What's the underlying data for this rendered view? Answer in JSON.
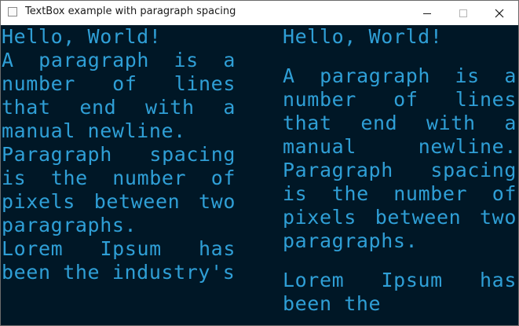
{
  "window": {
    "title": "TextBox example with paragraph spacing",
    "minimize_icon": "minimize-icon",
    "maximize_icon": "maximize-icon",
    "close_icon": "close-icon"
  },
  "colors": {
    "background": "#001726",
    "text": "#2f9fd6"
  },
  "left_textbox": {
    "paragraphs": [
      "Hello, World!",
      "A paragraph is a number of lines that end with a manual newline.",
      "Paragraph spacing is the number of pixels between two paragraphs.",
      "Lorem Ipsum has been the industry's"
    ]
  },
  "right_textbox": {
    "paragraphs": [
      "Hello, World!",
      "A paragraph is a number of lines that end with a manual newline. Paragraph spacing is the number of pixels between two paragraphs.",
      "Lorem Ipsum has been the"
    ]
  }
}
